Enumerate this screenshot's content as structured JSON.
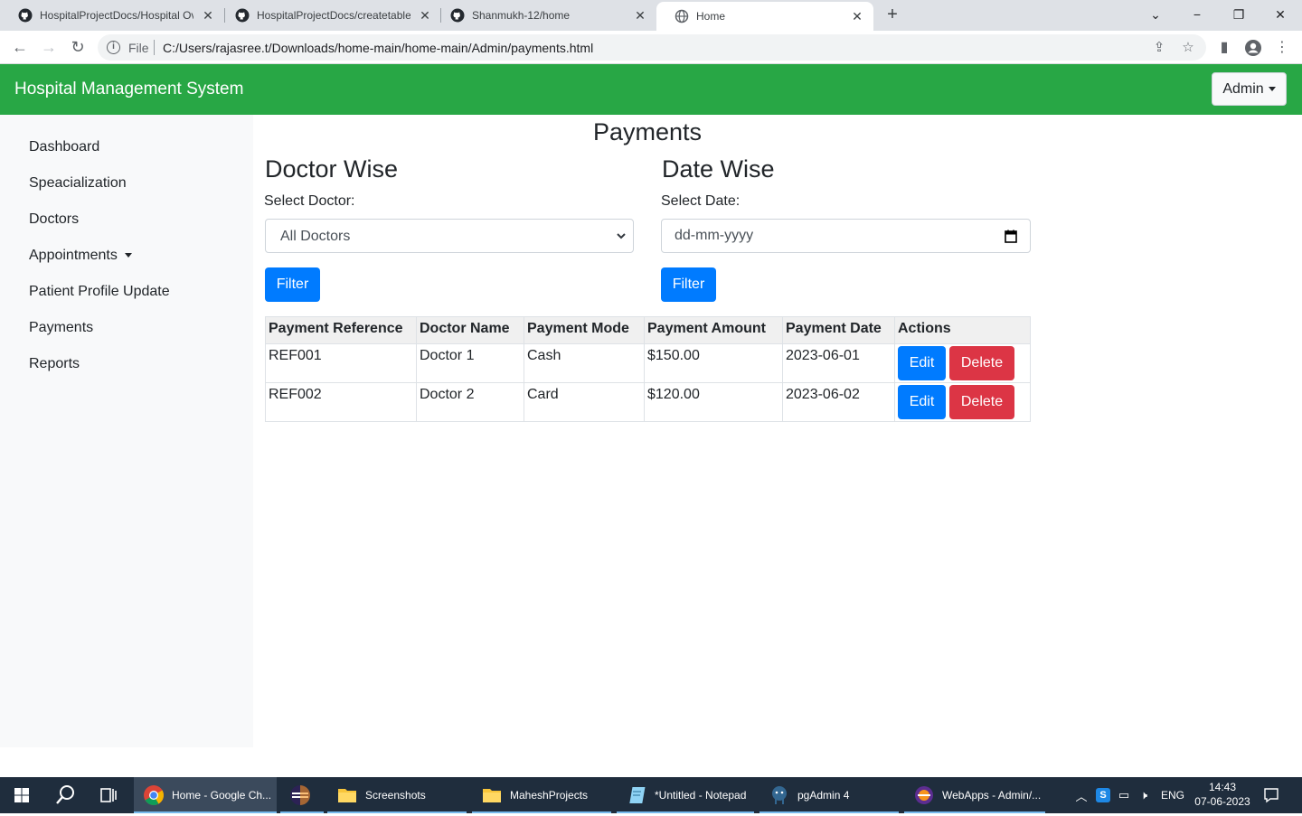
{
  "browser": {
    "tabs": [
      {
        "title": "HospitalProjectDocs/Hospital Ov",
        "icon": "github-icon",
        "active": false
      },
      {
        "title": "HospitalProjectDocs/createtables",
        "icon": "github-icon",
        "active": false
      },
      {
        "title": "Shanmukh-12/home",
        "icon": "github-icon",
        "active": false
      },
      {
        "title": "Home",
        "icon": "globe-icon",
        "active": true
      }
    ],
    "scheme": "File",
    "url": "C:/Users/rajasree.t/Downloads/home-main/home-main/Admin/payments.html"
  },
  "navbar": {
    "brand": "Hospital Management System",
    "user_menu": "Admin",
    "color": "#28a745"
  },
  "sidebar": {
    "items": [
      {
        "label": "Dashboard"
      },
      {
        "label": "Speacialization"
      },
      {
        "label": "Doctors"
      },
      {
        "label": "Appointments",
        "dropdown": true
      },
      {
        "label": "Patient Profile Update"
      },
      {
        "label": "Payments"
      },
      {
        "label": "Reports"
      }
    ]
  },
  "main": {
    "title": "Payments",
    "doctor_wise": {
      "heading": "Doctor Wise",
      "label": "Select Doctor:",
      "selected": "All Doctors",
      "button": "Filter"
    },
    "date_wise": {
      "heading": "Date Wise",
      "label": "Select Date:",
      "placeholder": "dd-mm-yyyy",
      "button": "Filter"
    },
    "table": {
      "headers": [
        "Payment Reference",
        "Doctor Name",
        "Payment Mode",
        "Payment Amount",
        "Payment Date",
        "Actions"
      ],
      "rows": [
        {
          "ref": "REF001",
          "doctor": "Doctor 1",
          "mode": "Cash",
          "amount": "$150.00",
          "date": "2023-06-01"
        },
        {
          "ref": "REF002",
          "doctor": "Doctor 2",
          "mode": "Card",
          "amount": "$120.00",
          "date": "2023-06-02"
        }
      ],
      "edit_label": "Edit",
      "delete_label": "Delete"
    },
    "colors": {
      "primary": "#007bff",
      "danger": "#dc3545"
    }
  },
  "taskbar": {
    "apps": [
      {
        "label": "Home - Google Ch...",
        "icon": "chrome-icon"
      },
      {
        "label": "",
        "icon": "eclipse-icon"
      },
      {
        "label": "Screenshots",
        "icon": "folder-icon"
      },
      {
        "label": "MaheshProjects",
        "icon": "folder-icon"
      },
      {
        "label": "*Untitled - Notepad",
        "icon": "notepad-icon"
      },
      {
        "label": "pgAdmin 4",
        "icon": "pgadmin-icon"
      },
      {
        "label": "WebApps - Admin/...",
        "icon": "eclipse-ee-icon"
      }
    ],
    "language": "ENG",
    "time": "14:43",
    "date": "07-06-2023"
  }
}
